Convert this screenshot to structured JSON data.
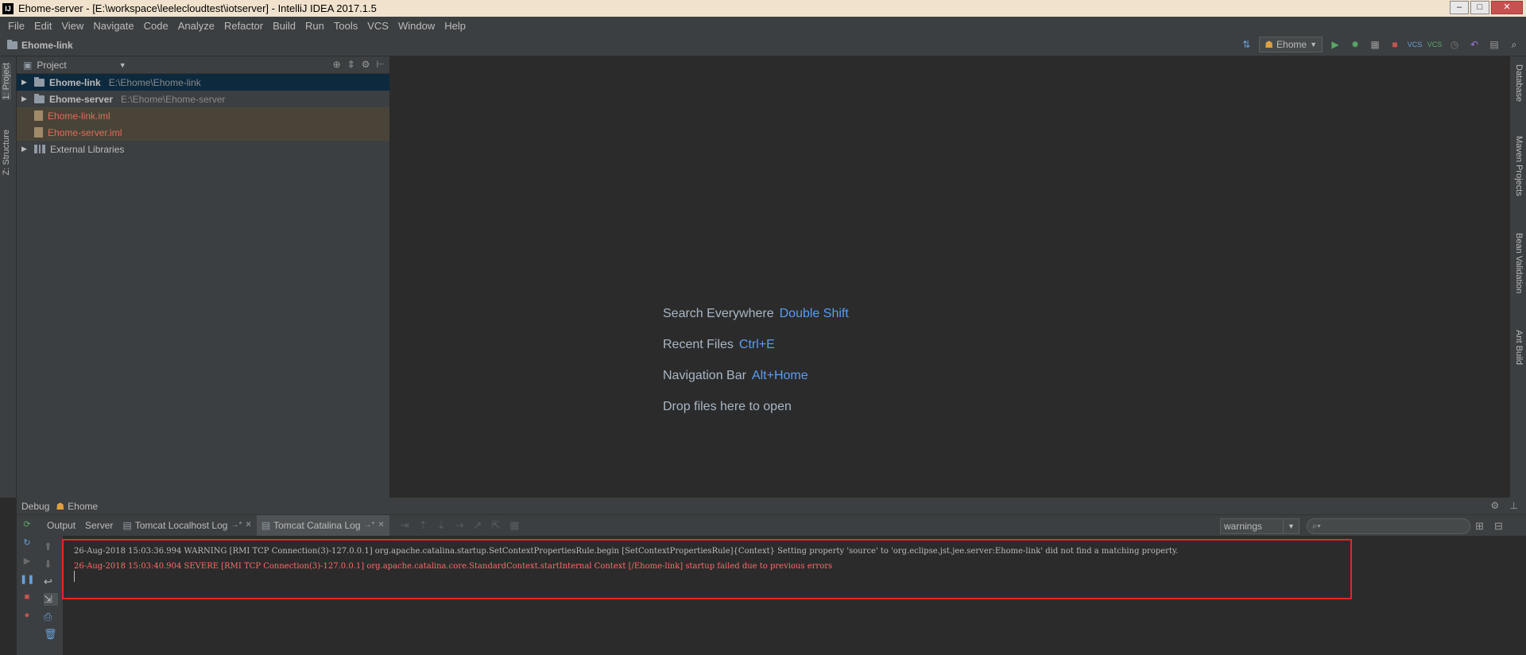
{
  "window": {
    "title": "Ehome-server - [E:\\workspace\\leelecloudtest\\iotserver] - IntelliJ IDEA 2017.1.5",
    "app_icon": "IJ"
  },
  "menu": [
    "File",
    "Edit",
    "View",
    "Navigate",
    "Code",
    "Analyze",
    "Refactor",
    "Build",
    "Run",
    "Tools",
    "VCS",
    "Window",
    "Help"
  ],
  "navbar": {
    "breadcrumb": "Ehome-link",
    "run_config": "Ehome"
  },
  "left_tabs": {
    "project": "1: Project",
    "structure": "Z: Structure"
  },
  "right_tabs": {
    "database": "Database",
    "maven": "Maven Projects",
    "bean": "Bean Validation",
    "ant": "Ant Build"
  },
  "project_panel": {
    "title": "Project",
    "tree": [
      {
        "name": "Ehome-link",
        "path": "E:\\Ehome\\Ehome-link"
      },
      {
        "name": "Ehome-server",
        "path": "E:\\Ehome\\Ehome-server"
      },
      {
        "name": "Ehome-link.iml"
      },
      {
        "name": "Ehome-server.iml"
      },
      {
        "name": "External Libraries"
      }
    ]
  },
  "editor_hints": [
    {
      "label": "Search Everywhere",
      "key": "Double Shift"
    },
    {
      "label": "Recent Files",
      "key": "Ctrl+E"
    },
    {
      "label": "Navigation Bar",
      "key": "Alt+Home"
    },
    {
      "label": "Drop files here to open",
      "key": ""
    }
  ],
  "debug": {
    "title": "Debug",
    "config": "Ehome",
    "tabs": [
      "Output",
      "Server",
      "Tomcat Localhost Log",
      "Tomcat Catalina Log"
    ],
    "filter": "warnings",
    "log": [
      "26-Aug-2018 15:03:36.994 WARNING [RMI TCP Connection(3)-127.0.0.1] org.apache.catalina.startup.SetContextPropertiesRule.begin [SetContextPropertiesRule]{Context} Setting property 'source' to 'org.eclipse.jst.jee.server:Ehome-link' did not find a matching property.",
      "26-Aug-2018 15:03:40.904 SEVERE [RMI TCP Connection(3)-127.0.0.1] org.apache.catalina.core.StandardContext.startInternal Context [/Ehome-link] startup failed due to previous errors"
    ]
  }
}
